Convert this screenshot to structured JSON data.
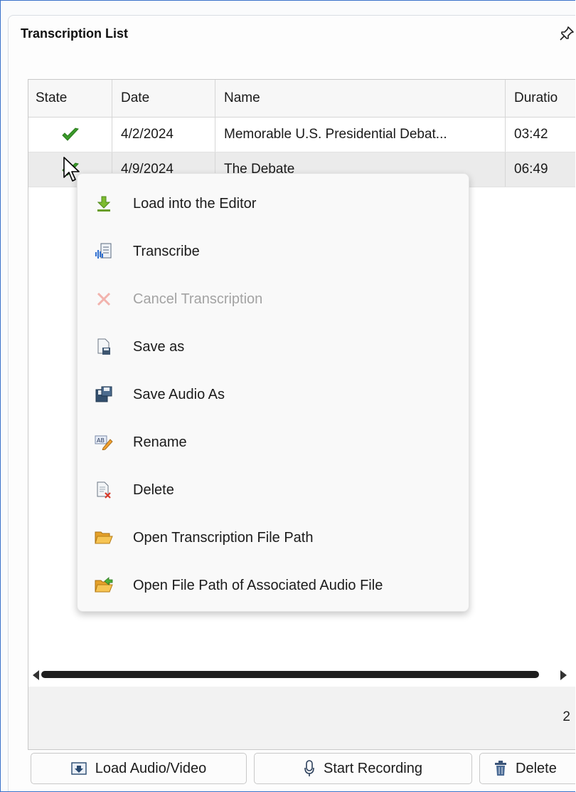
{
  "panel": {
    "title": "Transcription List"
  },
  "table": {
    "columns": [
      "State",
      "Date",
      "Name",
      "Duratio"
    ],
    "rows": [
      {
        "state_icon": "check-icon",
        "date": "4/2/2024",
        "name": "Memorable U.S. Presidential Debat...",
        "duration": "03:42"
      },
      {
        "state_icon": "check-icon",
        "date": "4/9/2024",
        "name": "The Debate",
        "duration": "06:49"
      }
    ],
    "count": "2"
  },
  "context_menu": {
    "items": [
      {
        "label": "Load into the Editor",
        "icon": "download-arrow-icon",
        "enabled": true
      },
      {
        "label": "Transcribe",
        "icon": "transcribe-icon",
        "enabled": true
      },
      {
        "label": "Cancel Transcription",
        "icon": "cancel-x-icon",
        "enabled": false
      },
      {
        "label": "Save as",
        "icon": "save-document-icon",
        "enabled": true
      },
      {
        "label": "Save Audio As",
        "icon": "save-audio-disk-icon",
        "enabled": true
      },
      {
        "label": "Rename",
        "icon": "rename-icon",
        "enabled": true
      },
      {
        "label": "Delete",
        "icon": "delete-document-icon",
        "enabled": true
      },
      {
        "label": "Open Transcription File Path",
        "icon": "folder-open-icon",
        "enabled": true
      },
      {
        "label": "Open File Path of Associated Audio File",
        "icon": "folder-export-icon",
        "enabled": true
      }
    ]
  },
  "buttons": {
    "load_audio_video": "Load Audio/Video",
    "start_recording": "Start Recording",
    "delete": "Delete"
  },
  "colors": {
    "accent_border": "#3a72c9",
    "check_green": "#3a9a2a",
    "selected_row": "#ebebeb"
  }
}
